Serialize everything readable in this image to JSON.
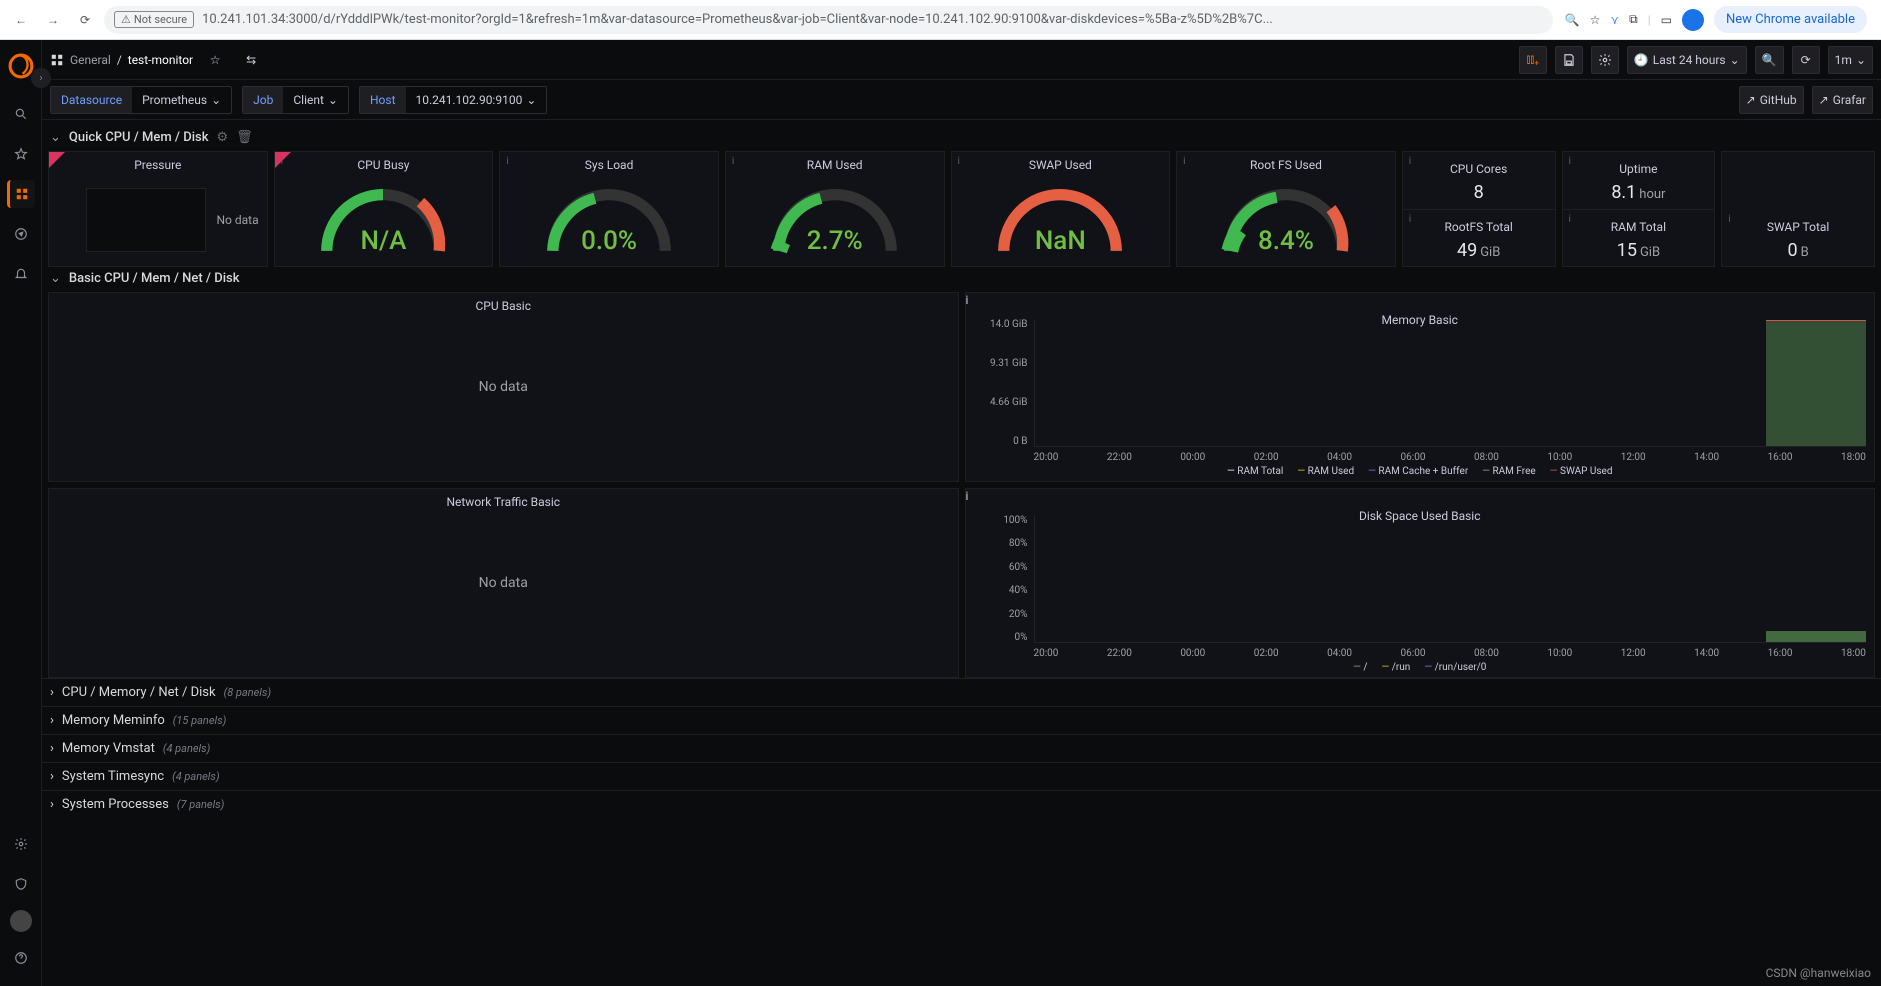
{
  "browser": {
    "not_secure": "Not secure",
    "url": "10.241.101.34:3000/d/rYdddlPWk/test-monitor?orgId=1&refresh=1m&var-datasource=Prometheus&var-job=Client&var-node=10.241.102.90:9100&var-diskdevices=%5Ba-z%5D%2B%7C...",
    "chrome_badge": "New Chrome available"
  },
  "header": {
    "folder": "General",
    "sep": "/",
    "dashboard": "test-monitor",
    "time_range": "Last 24 hours",
    "refresh": "1m",
    "github": "GitHub",
    "grafana": "Grafar"
  },
  "variables": {
    "datasource_label": "Datasource",
    "datasource_value": "Prometheus",
    "job_label": "Job",
    "job_value": "Client",
    "host_label": "Host",
    "host_value": "10.241.102.90:9100"
  },
  "section_quick": "Quick CPU / Mem / Disk",
  "section_basic": "Basic CPU / Mem / Net / Disk",
  "quick": {
    "pressure": {
      "title": "Pressure",
      "nodata": "No data"
    },
    "cpu_busy": {
      "title": "CPU Busy",
      "value": "N/A"
    },
    "sys_load": {
      "title": "Sys Load",
      "value": "0.0%"
    },
    "ram_used": {
      "title": "RAM Used",
      "value": "2.7%"
    },
    "swap_used": {
      "title": "SWAP Used",
      "value": "NaN"
    },
    "rootfs_used": {
      "title": "Root FS Used",
      "value": "8.4%"
    },
    "cores": {
      "title": "CPU Cores",
      "value": "8"
    },
    "uptime": {
      "title": "Uptime",
      "value": "8.1",
      "unit": "hour"
    },
    "rootfs_total": {
      "title": "RootFS Total",
      "value": "49",
      "unit": "GiB"
    },
    "ram_total": {
      "title": "RAM Total",
      "value": "15",
      "unit": "GiB"
    },
    "swap_total": {
      "title": "SWAP Total",
      "value": "0",
      "unit": "B"
    }
  },
  "basic": {
    "cpu": {
      "title": "CPU Basic",
      "nodata": "No data"
    },
    "memory": {
      "title": "Memory Basic"
    },
    "network": {
      "title": "Network Traffic Basic",
      "nodata": "No data"
    },
    "disk": {
      "title": "Disk Space Used Basic"
    }
  },
  "collapsed": [
    {
      "title": "CPU / Memory / Net / Disk",
      "count": "(8 panels)"
    },
    {
      "title": "Memory Meminfo",
      "count": "(15 panels)"
    },
    {
      "title": "Memory Vmstat",
      "count": "(4 panels)"
    },
    {
      "title": "System Timesync",
      "count": "(4 panels)"
    },
    {
      "title": "System Processes",
      "count": "(7 panels)"
    }
  ],
  "chart_data": [
    {
      "type": "area",
      "title": "Memory Basic",
      "ylabels": [
        "14.0 GiB",
        "9.31 GiB",
        "4.66 GiB",
        "0 B"
      ],
      "xlabels": [
        "20:00",
        "22:00",
        "00:00",
        "02:00",
        "04:00",
        "06:00",
        "08:00",
        "10:00",
        "12:00",
        "14:00",
        "16:00",
        "18:00"
      ],
      "legend": [
        "RAM Total",
        "RAM Used",
        "RAM Cache + Buffer",
        "RAM Free",
        "SWAP Used"
      ],
      "note": "Data only present for last ~12% of time range; RAM Total ≈ 15 GiB top line, RAM Free fills below"
    },
    {
      "type": "area",
      "title": "Disk Space Used Basic",
      "ylabels": [
        "100%",
        "80%",
        "60%",
        "40%",
        "20%",
        "0%"
      ],
      "xlabels": [
        "20:00",
        "22:00",
        "00:00",
        "02:00",
        "04:00",
        "06:00",
        "08:00",
        "10:00",
        "12:00",
        "14:00",
        "16:00",
        "18:00"
      ],
      "legend": [
        "/",
        "/run",
        "/run/user/0"
      ],
      "note": "Data only present for last ~12% of time range; / ≈ 8-9%"
    }
  ],
  "watermark": "CSDN @hanweixiao"
}
